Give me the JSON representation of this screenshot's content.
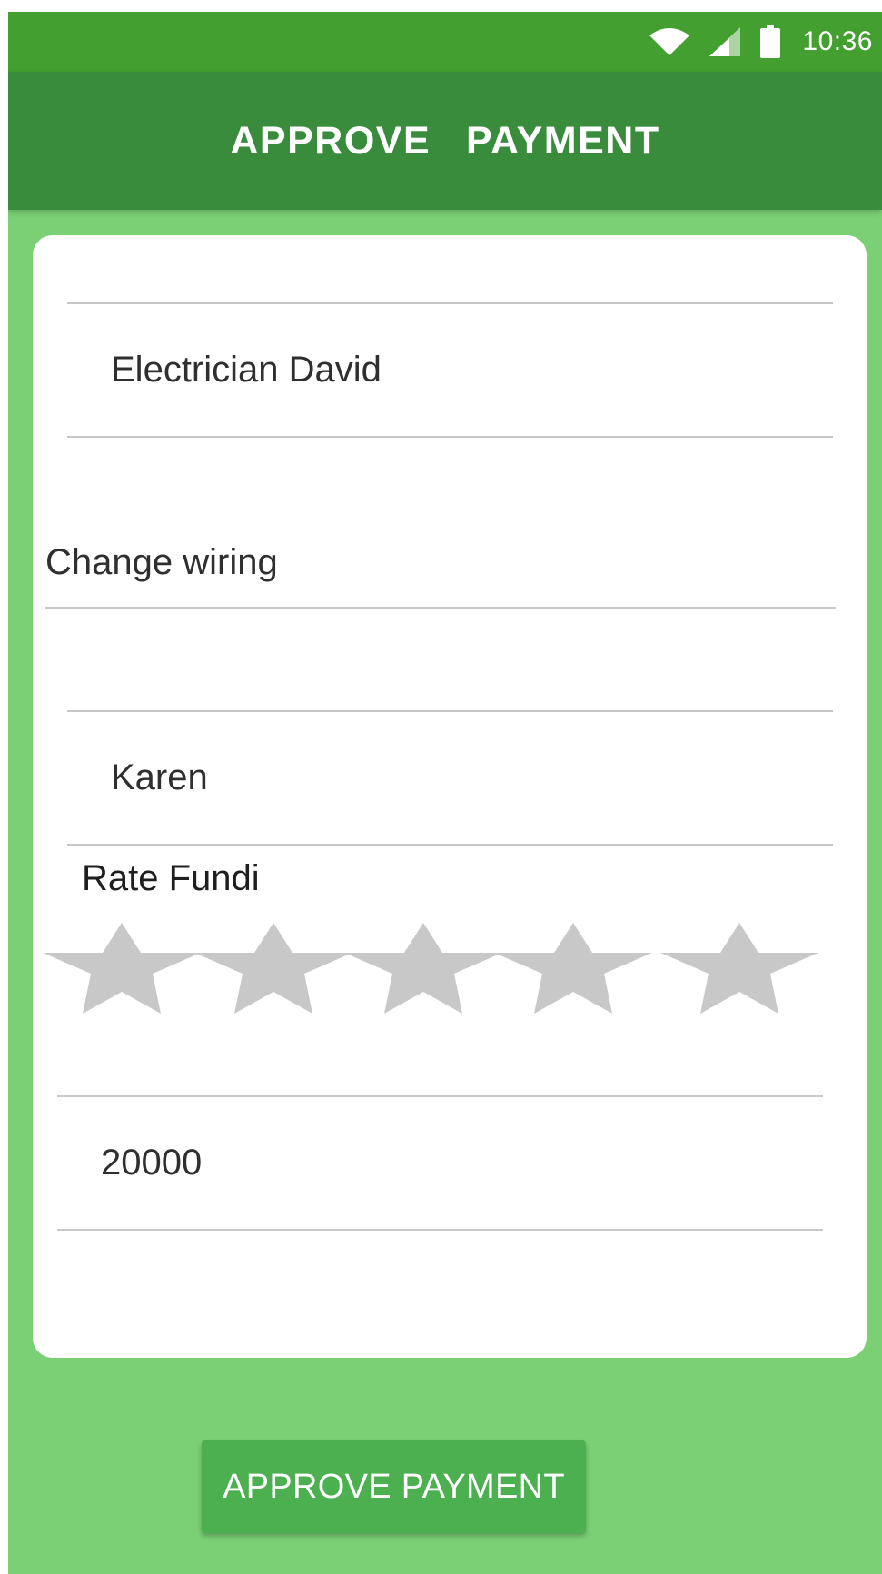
{
  "status_bar": {
    "time": "10:36",
    "icons": [
      "wifi-icon",
      "cell-signal-icon",
      "battery-icon"
    ]
  },
  "app_bar": {
    "title": "APPROVE  PAYMENT"
  },
  "form": {
    "fundi_name": "Electrician David",
    "job_description": "Change wiring",
    "client_name": "Karen",
    "rating_label": "Rate Fundi",
    "rating": {
      "value": 0,
      "max": 5,
      "star_color": "#c8c8c8"
    },
    "amount": "20000"
  },
  "approve_button": {
    "label": "APPROVE PAYMENT"
  },
  "colors": {
    "status_bar": "#43a030",
    "app_bar": "#398c3c",
    "background": "#7bd075",
    "button": "#4caf50",
    "card": "#ffffff"
  }
}
